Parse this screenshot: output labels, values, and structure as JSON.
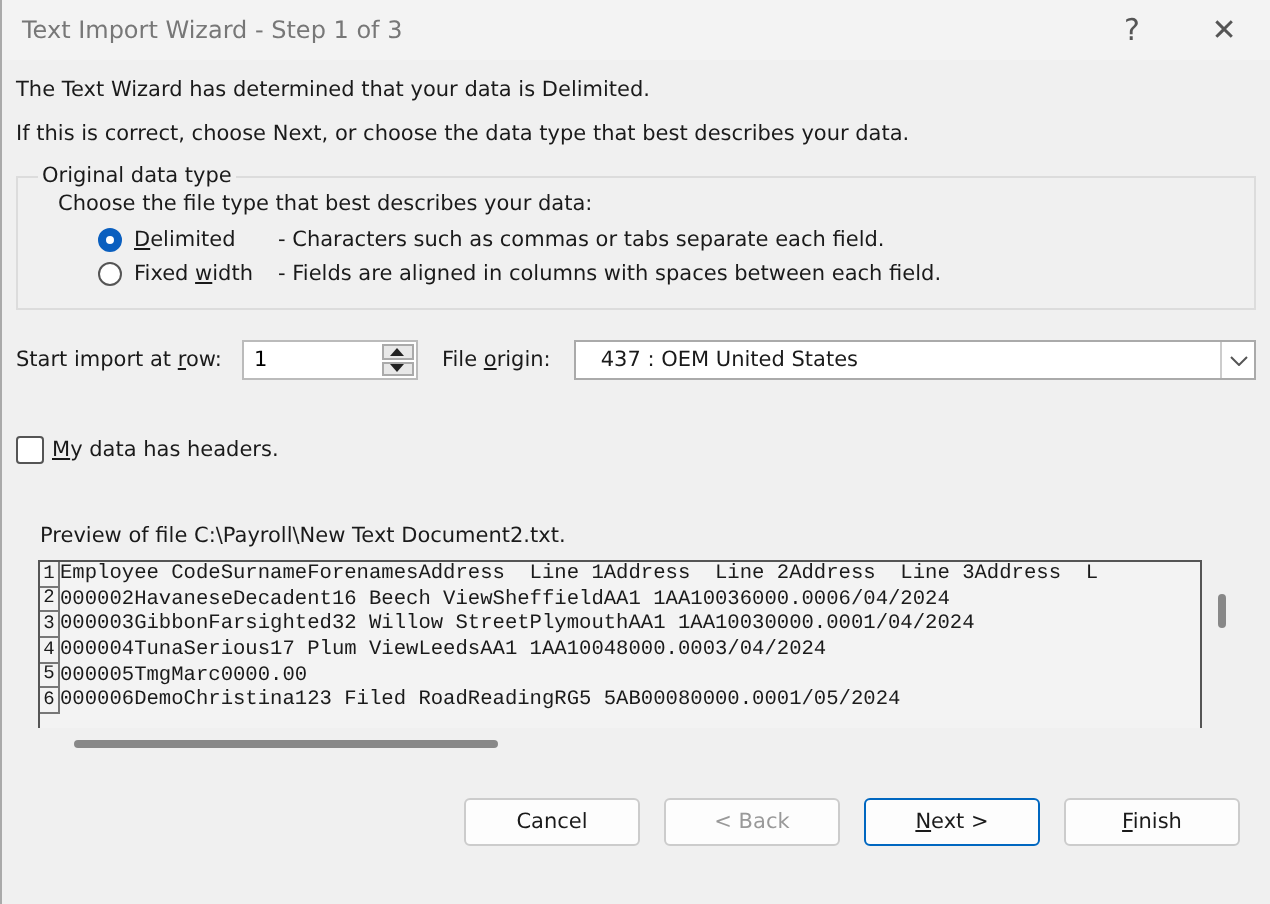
{
  "window": {
    "title": "Text Import Wizard - Step 1 of 3",
    "help": "?",
    "close": "✕"
  },
  "intro": [
    "The Text Wizard has determined that your data is Delimited.",
    "If this is correct, choose Next, or choose the data type that best describes your data."
  ],
  "data_type": {
    "legend": "Original data type",
    "prompt": "Choose the file type that best describes your data:",
    "options": [
      {
        "label": {
          "key": "D",
          "post": "elimited"
        },
        "description": "- Characters such as commas or tabs separate each field.",
        "selected": true
      },
      {
        "label": {
          "pre": "Fixed ",
          "key": "w",
          "post": "idth"
        },
        "description": "- Fields are aligned in columns with spaces between each field.",
        "selected": false
      }
    ]
  },
  "start_row": {
    "label": {
      "pre": "Start import at ",
      "key": "r",
      "post": "ow:"
    },
    "value": "1"
  },
  "file_origin": {
    "label": {
      "pre": "File ",
      "key": "o",
      "post": "rigin:"
    },
    "value": "437 : OEM United States"
  },
  "headers": {
    "label": {
      "key": "M",
      "post": "y data has headers."
    },
    "checked": false
  },
  "preview": {
    "title": "Preview of file C:\\Payroll\\New Text Document2.txt.",
    "lines": [
      {
        "number": "1",
        "text": "Employee CodeSurnameForenamesAddress  Line 1Address  Line 2Address  Line 3Address  L"
      },
      {
        "number": "2",
        "text": "000002HavaneseDecadent16 Beech ViewSheffieldAA1 1AA10036000.0006/04/2024"
      },
      {
        "number": "3",
        "text": "000003GibbonFarsighted32 Willow StreetPlymouthAA1 1AA10030000.0001/04/2024"
      },
      {
        "number": "4",
        "text": "000004TunaSerious17 Plum ViewLeedsAA1 1AA10048000.0003/04/2024"
      },
      {
        "number": "5",
        "text": "000005TmgMarc0000.00"
      },
      {
        "number": "6",
        "text": "000006DemoChristina123 Filed RoadReadingRG5 5AB00080000.0001/05/2024"
      }
    ]
  },
  "buttons": [
    {
      "label": {
        "pre": "Cancel"
      },
      "disabled": false,
      "default": false
    },
    {
      "label": {
        "pre": "< Back"
      },
      "disabled": true,
      "default": false
    },
    {
      "label": {
        "key": "N",
        "post": "ext >"
      },
      "disabled": false,
      "default": true
    },
    {
      "label": {
        "key": "F",
        "post": "inish"
      },
      "disabled": false,
      "default": false
    }
  ]
}
